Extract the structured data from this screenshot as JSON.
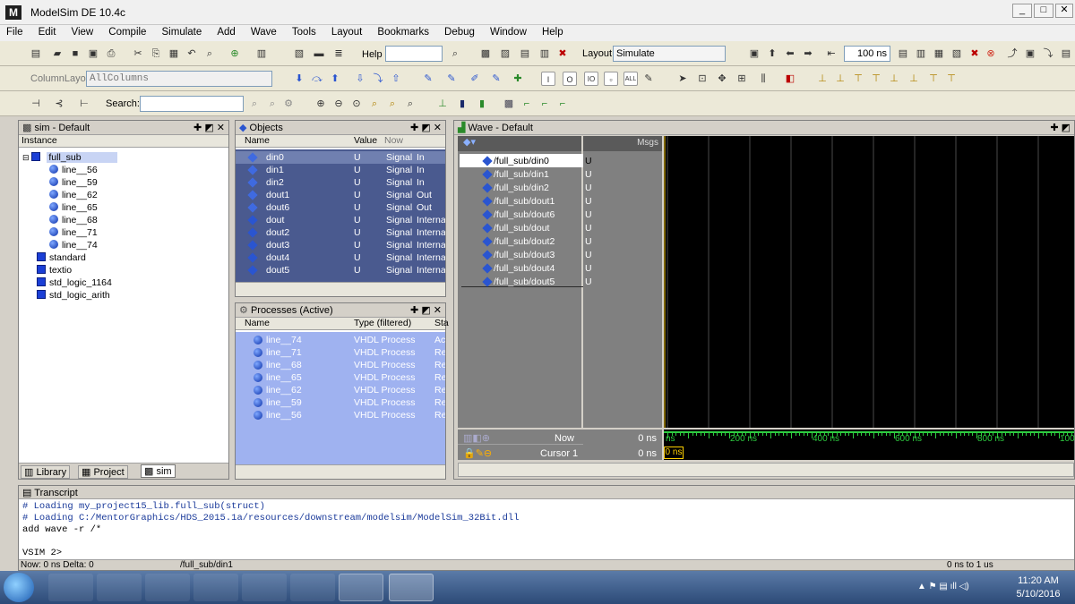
{
  "window": {
    "title": "ModelSim DE 10.4c",
    "app_icon": "M",
    "buttons": [
      "_",
      "□",
      "✕"
    ]
  },
  "menu": [
    "File",
    "Edit",
    "View",
    "Compile",
    "Simulate",
    "Add",
    "Wave",
    "Tools",
    "Layout",
    "Bookmarks",
    "Debug",
    "Window",
    "Help"
  ],
  "toolbar": {
    "help_label": "Help",
    "layout_label": "Layout",
    "layout_value": "Simulate",
    "time_value": "100 ns",
    "column_layout_label": "ColumnLayout",
    "column_layout_value": "AllColumns",
    "search_label": "Search:"
  },
  "sim_pane": {
    "title": "sim - Default",
    "col_instance": "Instance",
    "root": "full_sub",
    "children": [
      "line__56",
      "line__59",
      "line__62",
      "line__65",
      "line__68",
      "line__71",
      "line__74"
    ],
    "libs": [
      "standard",
      "textio",
      "std_logic_1164",
      "std_logic_arith"
    ],
    "tabs": [
      "Library",
      "Project",
      "sim"
    ]
  },
  "objects_pane": {
    "title": "Objects",
    "columns": [
      "Name",
      "Value",
      "Now"
    ],
    "rows": [
      {
        "name": "din0",
        "value": "U",
        "kind": "Signal",
        "mode": "In"
      },
      {
        "name": "din1",
        "value": "U",
        "kind": "Signal",
        "mode": "In"
      },
      {
        "name": "din2",
        "value": "U",
        "kind": "Signal",
        "mode": "In"
      },
      {
        "name": "dout1",
        "value": "U",
        "kind": "Signal",
        "mode": "Out"
      },
      {
        "name": "dout6",
        "value": "U",
        "kind": "Signal",
        "mode": "Out"
      },
      {
        "name": "dout",
        "value": "U",
        "kind": "Signal",
        "mode": "Interna"
      },
      {
        "name": "dout2",
        "value": "U",
        "kind": "Signal",
        "mode": "Interna"
      },
      {
        "name": "dout3",
        "value": "U",
        "kind": "Signal",
        "mode": "Interna"
      },
      {
        "name": "dout4",
        "value": "U",
        "kind": "Signal",
        "mode": "Interna"
      },
      {
        "name": "dout5",
        "value": "U",
        "kind": "Signal",
        "mode": "Interna"
      }
    ]
  },
  "processes_pane": {
    "title": "Processes (Active)",
    "columns": [
      "Name",
      "Type (filtered)",
      "Sta"
    ],
    "rows": [
      {
        "name": "line__74",
        "type": "VHDL Process",
        "state": "Ac"
      },
      {
        "name": "line__71",
        "type": "VHDL Process",
        "state": "Re"
      },
      {
        "name": "line__68",
        "type": "VHDL Process",
        "state": "Re"
      },
      {
        "name": "line__65",
        "type": "VHDL Process",
        "state": "Re"
      },
      {
        "name": "line__62",
        "type": "VHDL Process",
        "state": "Re"
      },
      {
        "name": "line__59",
        "type": "VHDL Process",
        "state": "Re"
      },
      {
        "name": "line__56",
        "type": "VHDL Process",
        "state": "Re"
      }
    ]
  },
  "wave_pane": {
    "title": "Wave - Default",
    "msgs_label": "Msgs",
    "signals": [
      "/full_sub/din0",
      "/full_sub/din1",
      "/full_sub/din2",
      "/full_sub/dout1",
      "/full_sub/dout6",
      "/full_sub/dout",
      "/full_sub/dout2",
      "/full_sub/dout3",
      "/full_sub/dout4",
      "/full_sub/dout5"
    ],
    "values": [
      "U",
      "U",
      "U",
      "U",
      "U",
      "U",
      "U",
      "U",
      "U",
      "U"
    ],
    "now_label": "Now",
    "now_value": "0 ns",
    "cursor_label": "Cursor 1",
    "cursor_value": "0 ns",
    "ruler": [
      "ns",
      "200 ns",
      "400 ns",
      "600 ns",
      "800 ns",
      "100"
    ],
    "cursor_box": "0 ns"
  },
  "transcript": {
    "title": "Transcript",
    "lines": [
      "# Loading my_project15_lib.full_sub(struct)",
      "# Loading C:/MentorGraphics/HDS_2015.1a/resources/downstream/modelsim/ModelSim_32Bit.dll",
      "add wave -r /*",
      "",
      "VSIM 2>"
    ],
    "status_left": "Now: 0 ns  Delta: 0",
    "status_mid": "/full_sub/din1",
    "status_right": "0 ns to 1 us"
  },
  "taskbar": {
    "time": "11:20 AM",
    "date": "5/10/2016"
  },
  "colors": {
    "selection": "#4a5a8f",
    "process_bg": "#9fb2f0",
    "wave_bg": "#000000",
    "wave_grid": "#4a4a4a",
    "ruler_green": "#2ecc40",
    "cursor_yellow": "#ffd000"
  }
}
